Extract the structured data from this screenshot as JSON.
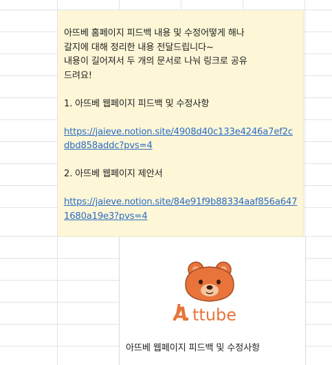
{
  "note": {
    "line1": "아뜨베 홈페이지 피드백 내용 및 수정어떻게 해나",
    "line2": "갈지에 대해 정리한 내용 전달드립니다~",
    "line3": "내용이 길어져서 두 개의 문서로 나눠 링크로 공유",
    "line4": "드려요!",
    "item1_title": "1. 아뜨베 웹페이지 피드백 및 수정사항",
    "item1_link": "https://jaieve.notion.site/4908d40c133e4246a7ef2cdbd858addc?pvs=4",
    "item2_title": "2. 아뜨베 웹페이지 제안서",
    "item2_link": "https://jaieve.notion.site/84e91f9b88334aaf856a6471680a19e3?pvs=4"
  },
  "card": {
    "logo_text_a": "A",
    "logo_text_rest": "ttube",
    "title": "아뜨베 웹페이지 피드백 및 수정사항"
  },
  "colors": {
    "note_bg": "#fdf6d7",
    "link": "#2a6cc4",
    "logo_orange": "#e8743b",
    "grid": "#e2e3e3"
  }
}
